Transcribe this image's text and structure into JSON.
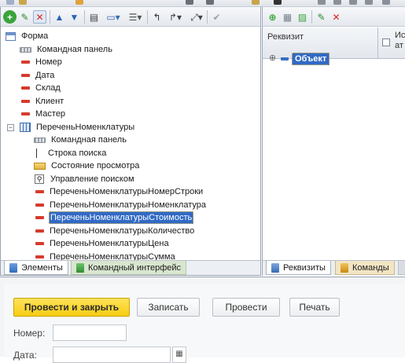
{
  "left_toolbar": {
    "icons": [
      "add-icon",
      "edit-icon",
      "delete-icon",
      "move-up-icon",
      "move-down-icon",
      "form-properties-icon",
      "display-menu-icon",
      "list-menu-icon",
      "undo-icon",
      "redo-menu-icon",
      "check-icon"
    ]
  },
  "tree": {
    "items": [
      {
        "label": "Форма",
        "icon": "form-icon"
      },
      {
        "label": "Командная панель",
        "icon": "command-bar-icon"
      },
      {
        "label": "Номер",
        "icon": "field-icon"
      },
      {
        "label": "Дата",
        "icon": "field-icon"
      },
      {
        "label": "Склад",
        "icon": "field-icon"
      },
      {
        "label": "Клиент",
        "icon": "field-icon"
      },
      {
        "label": "Мастер",
        "icon": "field-icon"
      },
      {
        "label": "ПереченьНоменклатуры",
        "icon": "table-icon"
      },
      {
        "label": "Командная панель",
        "icon": "command-bar-icon"
      },
      {
        "label": "Строка поиска",
        "icon": "search-string-icon"
      },
      {
        "label": "Состояние просмотра",
        "icon": "view-state-icon"
      },
      {
        "label": "Управление поиском",
        "icon": "search-control-icon"
      },
      {
        "label": "ПереченьНоменклатурыНомерСтроки",
        "icon": "field-icon"
      },
      {
        "label": "ПереченьНоменклатурыНоменклатура",
        "icon": "field-icon"
      },
      {
        "label": "ПереченьНоменклатурыСтоимость",
        "icon": "field-icon",
        "selected": true
      },
      {
        "label": "ПереченьНоменклатурыКоличество",
        "icon": "field-icon"
      },
      {
        "label": "ПереченьНоменклатурыЦена",
        "icon": "field-icon"
      },
      {
        "label": "ПереченьНоменклатурыСумма",
        "icon": "field-icon"
      }
    ]
  },
  "left_tabs": {
    "elements": "Элементы",
    "command_interface": "Командный интерфейс"
  },
  "right_panel": {
    "column_attribute": "Реквизит",
    "column_second": "Ис ат",
    "object_label": "Объект",
    "tabs": {
      "attributes": "Реквизиты",
      "commands": "Команды"
    }
  },
  "form_preview": {
    "post_and_close": "Провести и закрыть",
    "write": "Записать",
    "post": "Провести",
    "print": "Печать",
    "number_label": "Номер:",
    "date_label": "Дата:"
  },
  "colors": {
    "selection": "#316ac5",
    "primary_button": "#f6cd12",
    "field_icon": "#d63a2c"
  }
}
